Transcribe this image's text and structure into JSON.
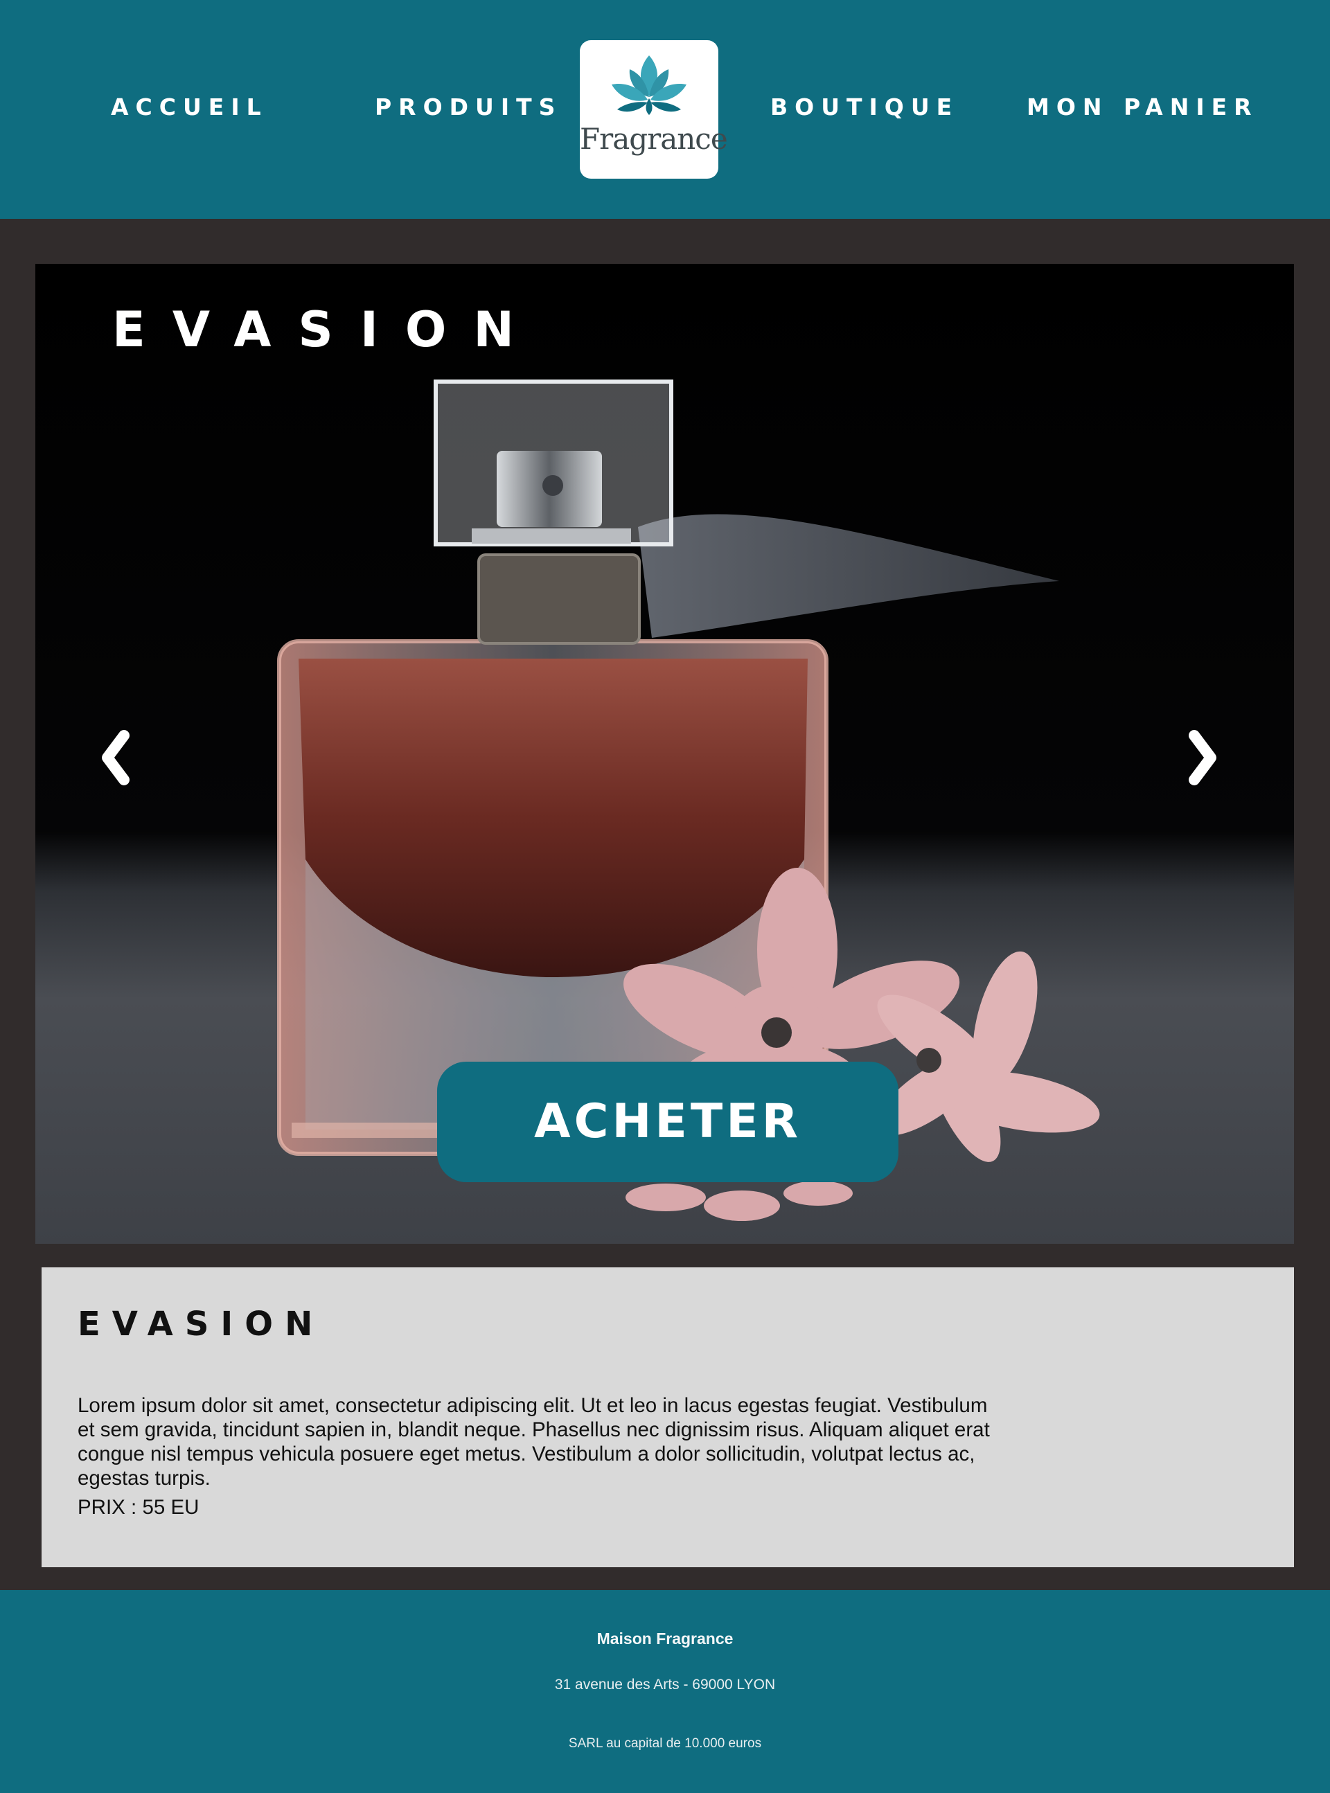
{
  "nav": {
    "accueil": "ACCUEIL",
    "produits": "PRODUITS",
    "boutique": "BOUTIQUE",
    "panier": "MON PANIER"
  },
  "logo": {
    "text": "Fragrance",
    "icon": "lotus-icon"
  },
  "hero": {
    "title": "EVASION",
    "prev_icon": "chevron-left-icon",
    "next_icon": "chevron-right-icon",
    "buy_label": "ACHETER"
  },
  "product": {
    "title": "EVASION",
    "description": "Lorem ipsum dolor sit amet, consectetur adipiscing elit. Ut et leo in lacus egestas feugiat. Vestibulum et sem gravida, tincidunt sapien in, blandit neque. Phasellus nec dignissim risus. Aliquam aliquet erat congue nisl tempus vehicula posuere eget metus. Vestibulum a dolor sollicitudin, volutpat lectus ac, egestas turpis.",
    "price": "PRIX : 55 EU"
  },
  "footer": {
    "company": "Maison Fragrance",
    "address": "31 avenue des Arts - 69000 LYON",
    "legal": "SARL au capital de 10.000 euros"
  },
  "colors": {
    "brand_teal": "#0f6d80",
    "page_background": "#312c2c",
    "panel_background": "#d9d9d9",
    "logo_teal": "#3aa6b9"
  }
}
